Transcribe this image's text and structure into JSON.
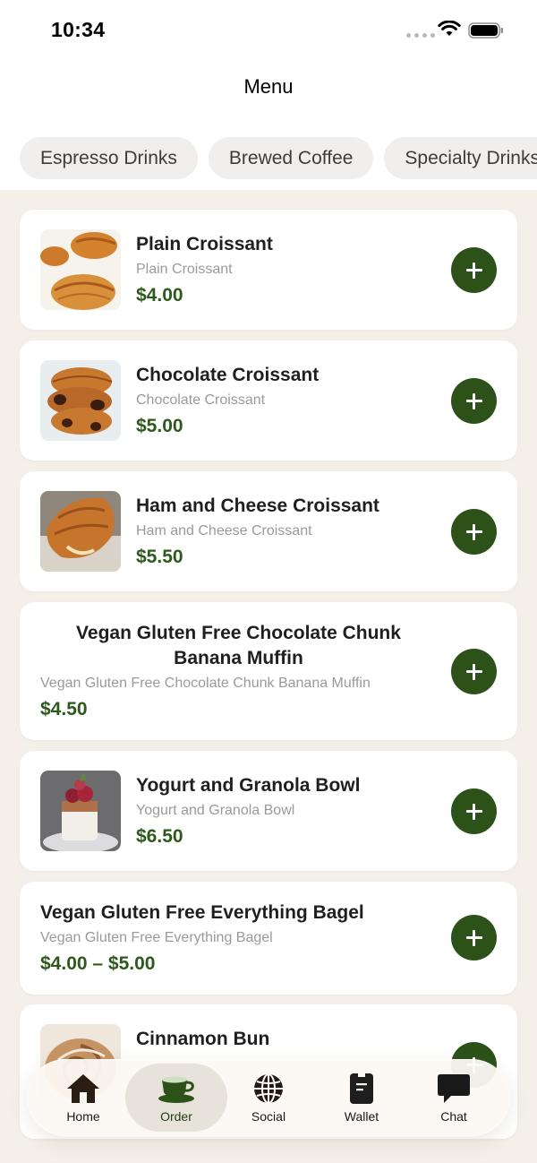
{
  "status_bar": {
    "time": "10:34"
  },
  "header": {
    "title": "Menu"
  },
  "tabs": [
    {
      "label": "Espresso Drinks"
    },
    {
      "label": "Brewed Coffee"
    },
    {
      "label": "Specialty Drinks"
    }
  ],
  "items": [
    {
      "name": "Plain Croissant",
      "description": "Plain Croissant",
      "price": "$4.00"
    },
    {
      "name": "Chocolate Croissant",
      "description": "Chocolate Croissant",
      "price": "$5.00"
    },
    {
      "name": "Ham and Cheese Croissant",
      "description": "Ham and Cheese Croissant",
      "price": "$5.50"
    },
    {
      "name": "Vegan Gluten Free Chocolate Chunk Banana Muffin",
      "description": "Vegan Gluten Free Chocolate Chunk Banana Muffin",
      "price": "$4.50"
    },
    {
      "name": "Yogurt and Granola Bowl",
      "description": "Yogurt and Granola Bowl",
      "price": "$6.50"
    },
    {
      "name": "Vegan Gluten Free Everything Bagel",
      "description": "Vegan Gluten Free Everything Bagel",
      "price": "$4.00 – $5.00"
    },
    {
      "name": "Cinnamon Bun"
    }
  ],
  "nav": [
    {
      "label": "Home",
      "icon": "home-icon"
    },
    {
      "label": "Order",
      "icon": "coffee-cup-icon",
      "active": true
    },
    {
      "label": "Social",
      "icon": "globe-icon"
    },
    {
      "label": "Wallet",
      "icon": "wallet-card-icon"
    },
    {
      "label": "Chat",
      "icon": "chat-bubble-icon"
    }
  ],
  "colors": {
    "accent_green": "#2c5219",
    "price_green": "#2d5a1c",
    "page_background": "#f4efe9"
  }
}
